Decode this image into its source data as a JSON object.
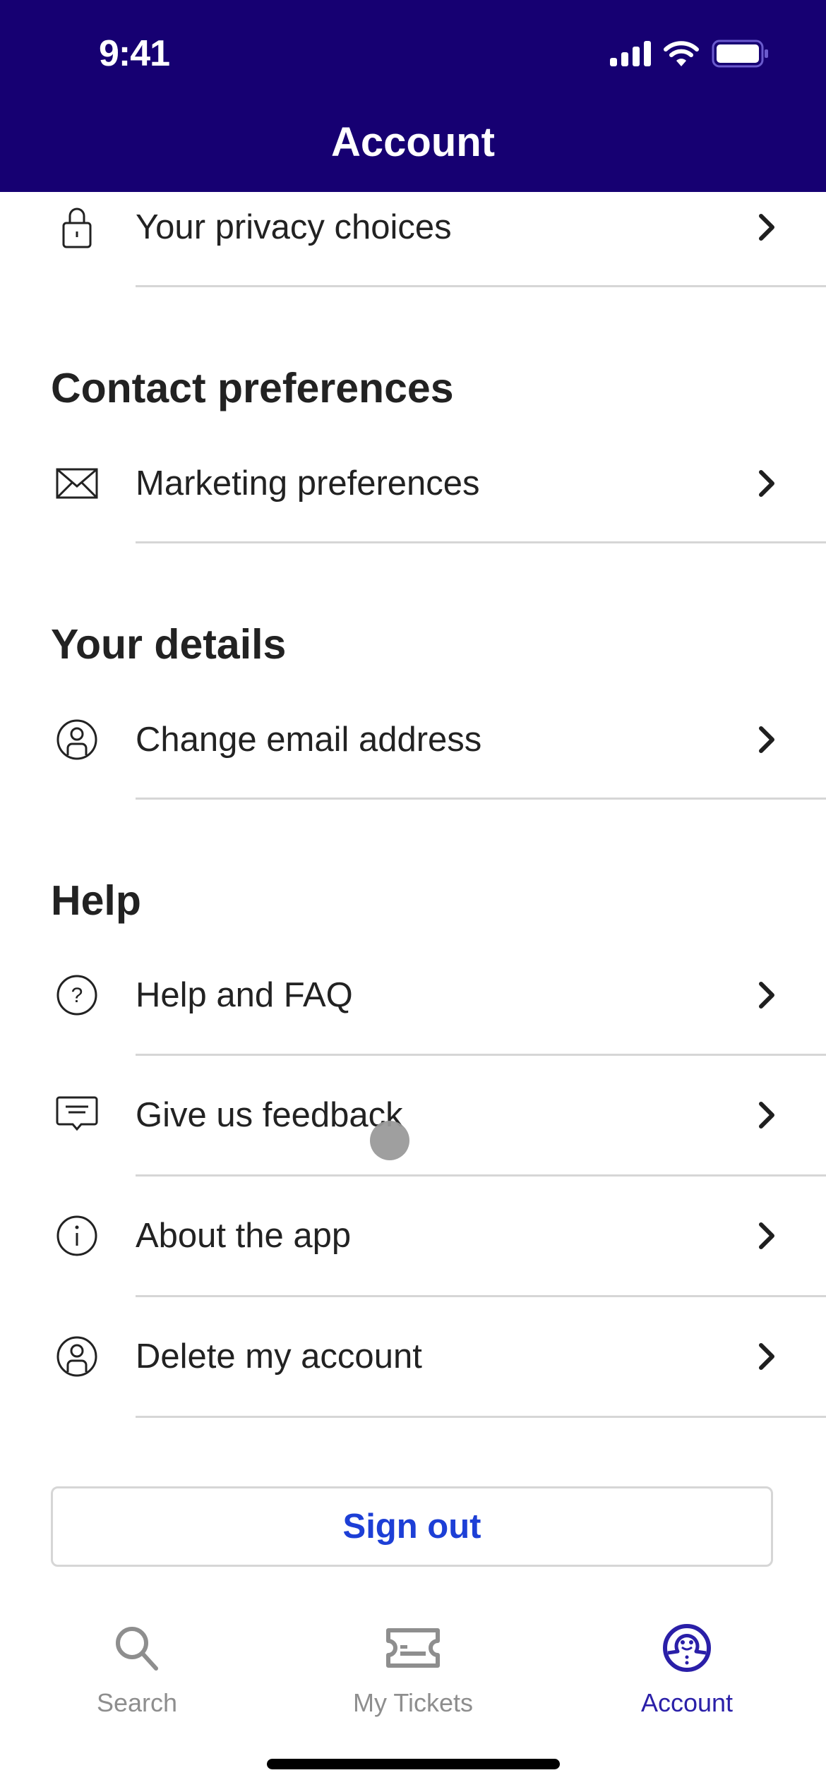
{
  "status_bar": {
    "time": "9:41",
    "icons": [
      "signal-icon",
      "wifi-icon",
      "battery-icon"
    ]
  },
  "header": {
    "title": "Account",
    "background": "#160072"
  },
  "rows": {
    "privacy": {
      "label": "Your privacy choices",
      "icon": "lock-icon"
    },
    "marketing": {
      "label": "Marketing preferences",
      "icon": "envelope-icon"
    },
    "email": {
      "label": "Change email address",
      "icon": "person-circle-icon"
    },
    "help_faq": {
      "label": "Help and FAQ",
      "icon": "question-circle-icon"
    },
    "feedback": {
      "label": "Give us feedback",
      "icon": "chat-bubble-icon"
    },
    "about": {
      "label": "About the app",
      "icon": "info-circle-icon"
    },
    "delete": {
      "label": "Delete my account",
      "icon": "person-circle-icon"
    }
  },
  "sections": {
    "contact": "Contact preferences",
    "details": "Your details",
    "help": "Help"
  },
  "sign_out": {
    "label": "Sign out",
    "color": "#1d3fd6"
  },
  "tab_bar": {
    "active": "Account",
    "active_color": "#2a1fa8",
    "inactive_color": "#8e8e8e",
    "tabs": [
      {
        "label": "Search",
        "icon": "search-icon"
      },
      {
        "label": "My Tickets",
        "icon": "ticket-icon"
      },
      {
        "label": "Account",
        "icon": "account-mascot-icon"
      }
    ]
  }
}
